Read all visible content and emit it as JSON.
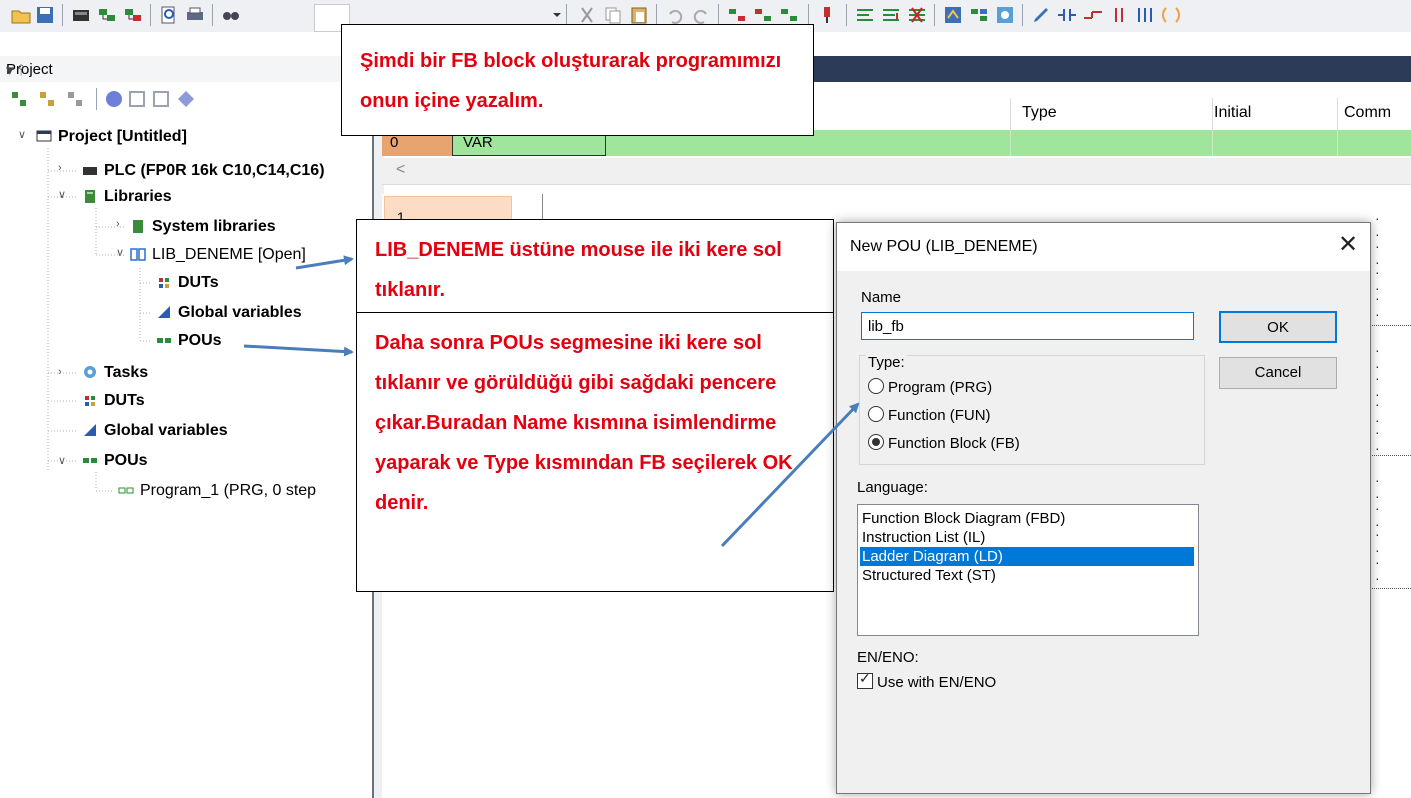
{
  "toolbar": {
    "icons": [
      "open-folder-icon",
      "save-icon",
      "device-icon",
      "compile-icon",
      "compile-all-icon",
      "print-preview-icon",
      "print-icon",
      "find-icon",
      "dropdown-icon",
      "cut-icon",
      "copy-icon",
      "paste-icon",
      "undo-icon",
      "redo-icon",
      "ladder-icon-1",
      "ladder-icon-2",
      "ladder-icon-3",
      "monitor-icon",
      "network-icon-1",
      "network-icon-2",
      "delete-network-icon",
      "pou-icon",
      "grid-icon",
      "online-icon",
      "pencil-icon",
      "contact-icon",
      "coil-icon",
      "parallel-icon",
      "function-icon",
      "box-icon"
    ]
  },
  "project": {
    "title": "Project",
    "tree": {
      "project_root": "Project [Untitled]",
      "plc": "PLC (FP0R 16k C10,C14,C16)",
      "libraries": "Libraries",
      "system_libraries": "System libraries",
      "lib_deneme": "LIB_DENEME [Open]",
      "lib_duts": "DUTs",
      "lib_global_variables": "Global variables",
      "lib_pous": "POUs",
      "tasks": "Tasks",
      "duts": "DUTs",
      "global_variables": "Global variables",
      "pous": "POUs",
      "program_1": "Program_1 (PRG, 0 step"
    }
  },
  "editor": {
    "columns": {
      "type": "Type",
      "initial": "Initial",
      "comment": "Comm"
    },
    "row": {
      "number": "0",
      "value": "VAR"
    },
    "scroll_left": "<",
    "ld_row": "1"
  },
  "callouts": {
    "top": "Şimdi bir FB block oluşturarak programımızı onun içine yazalım.",
    "middle": "LIB_DENEME üstüne mouse ile iki kere sol tıklanır.",
    "bottom": "Daha sonra POUs segmesine iki kere sol tıklanır ve görüldüğü gibi sağdaki pencere çıkar.Buradan Name kısmına isimlendirme yaparak ve Type kısmından FB seçilerek OK denir."
  },
  "dialog": {
    "title": "New POU (LIB_DENEME)",
    "close": "✕",
    "name_label": "Name",
    "name_value": "lib_fb",
    "ok_label": "OK",
    "cancel_label": "Cancel",
    "type_label": "Type:",
    "type_options": [
      "Program (PRG)",
      "Function (FUN)",
      "Function Block (FB)"
    ],
    "type_selected": "Function Block (FB)",
    "language_label": "Language:",
    "language_options": [
      "Function Block Diagram (FBD)",
      "Instruction List (IL)",
      "Ladder Diagram (LD)",
      "Structured Text (ST)"
    ],
    "language_selected": "Ladder Diagram (LD)",
    "en_eno_label": "EN/ENO:",
    "en_eno_checkbox": "Use with EN/ENO",
    "en_eno_checked": true
  },
  "colors": {
    "annotation_text": "#e3000f",
    "arrow": "#4a7ebb",
    "var_row": "#9fe59c",
    "row_number": "#e8a46f",
    "selection": "#0078d7",
    "editor_tab_bar": "#2c3b57"
  }
}
